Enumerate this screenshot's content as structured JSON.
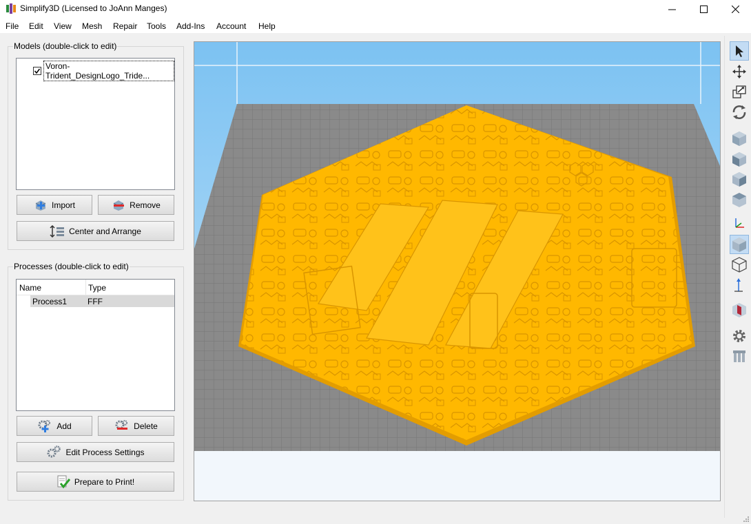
{
  "window": {
    "title": "Simplify3D (Licensed to JoAnn Manges)"
  },
  "menu": [
    "File",
    "Edit",
    "View",
    "Mesh",
    "Repair",
    "Tools",
    "Add-Ins",
    "Account",
    "Help"
  ],
  "models": {
    "label": "Models (double-click to edit)",
    "items": [
      {
        "name": "Voron-Trident_DesignLogo_Tride...",
        "checked": true
      }
    ],
    "import_label": "Import",
    "remove_label": "Remove",
    "center_label": "Center and Arrange"
  },
  "processes": {
    "label": "Processes (double-click to edit)",
    "columns": [
      "Name",
      "Type"
    ],
    "rows": [
      {
        "name": "Process1",
        "type": "FFF"
      }
    ],
    "add_label": "Add",
    "delete_label": "Delete",
    "edit_label": "Edit Process Settings",
    "prepare_label": "Prepare to Print!"
  },
  "colors": {
    "model": "#ffb800",
    "bed": "#8a8a8a",
    "sky": "#a6d4f6",
    "selection": "#c3dcf4"
  },
  "toolbar_icons": [
    "select-icon",
    "move-icon",
    "scale-icon",
    "rotate-icon",
    "view-iso-icon",
    "view-front-icon",
    "view-side-icon",
    "view-top-icon",
    "axes-icon",
    "solid-view-icon",
    "wireframe-view-icon",
    "axis-arrow-icon",
    "cross-section-icon",
    "settings-gear-icon",
    "supports-icon"
  ]
}
